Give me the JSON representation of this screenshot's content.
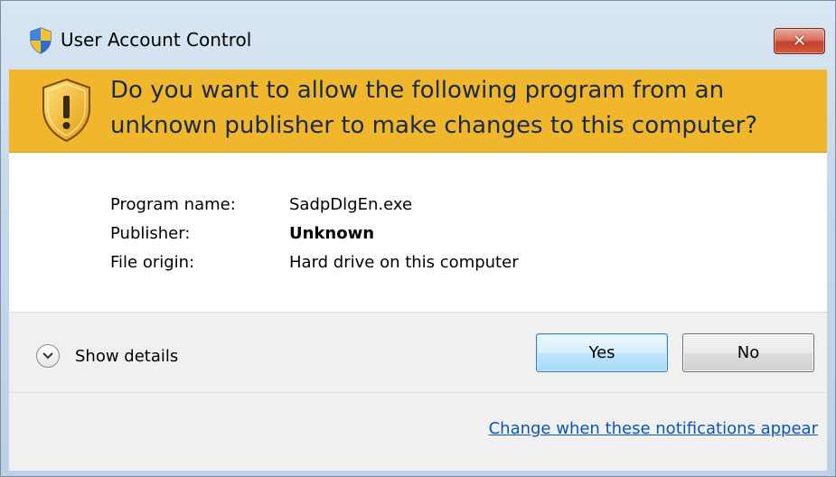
{
  "window": {
    "title": "User Account Control",
    "close_glyph": "✕",
    "icons": {
      "title": "uac-shield-icon",
      "close": "close-icon",
      "banner": "shield-warning-icon",
      "details": "chevron-down-icon"
    }
  },
  "banner": {
    "message": "Do you want to allow the following program from an unknown publisher to make changes to this computer?",
    "color": "#f0b72d"
  },
  "info": {
    "rows": [
      {
        "label": "Program name:",
        "value": "SadpDlgEn.exe"
      },
      {
        "label": "Publisher:",
        "value": "Unknown"
      },
      {
        "label": "File origin:",
        "value": "Hard drive on this computer"
      }
    ]
  },
  "footer": {
    "details_label": "Show details",
    "yes_label": "Yes",
    "no_label": "No",
    "link_text": "Change when these notifications appear",
    "link_color": "#0c55b4"
  }
}
